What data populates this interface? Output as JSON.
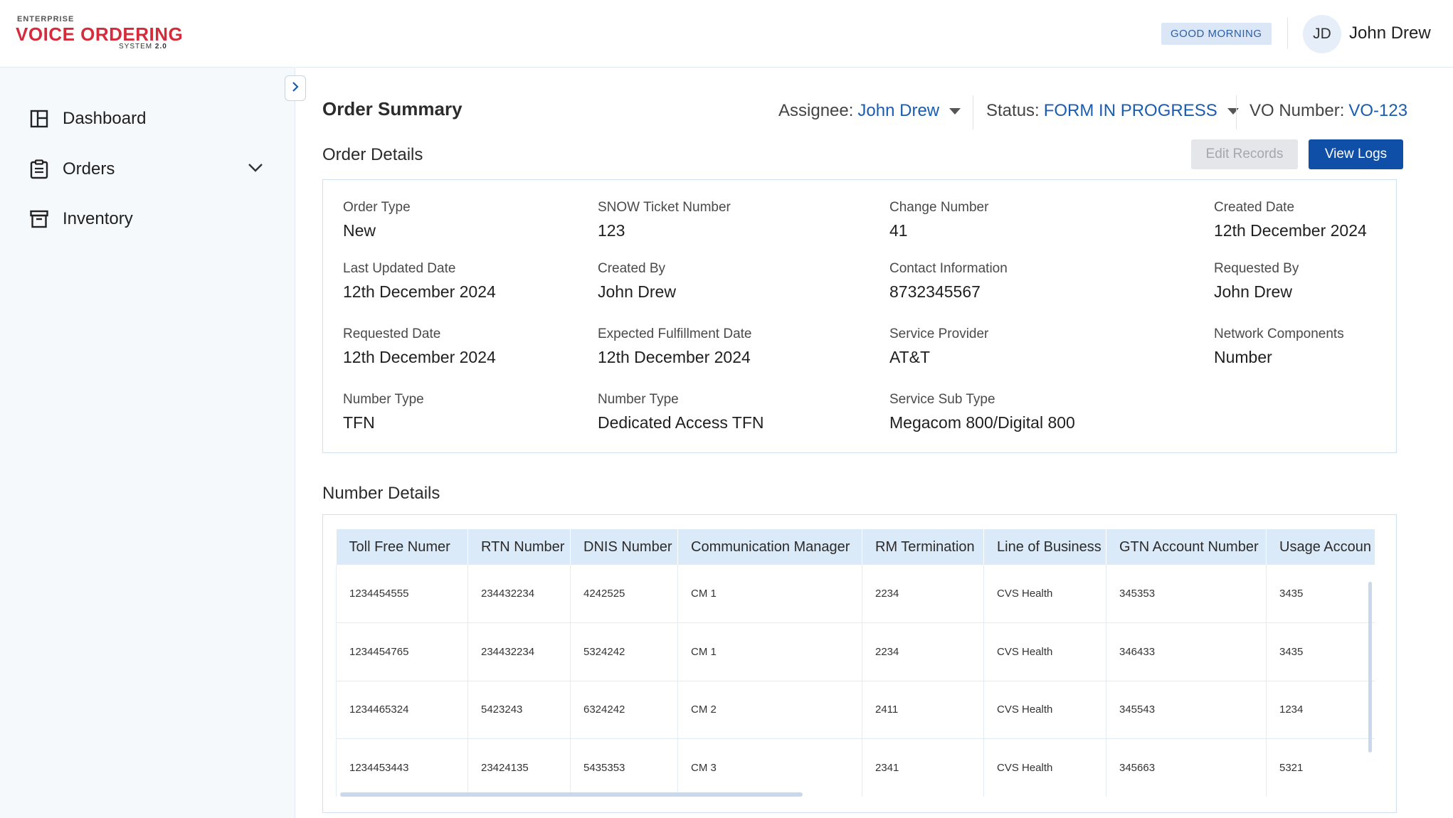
{
  "app": {
    "logo_top": "ENTERPRISE",
    "logo_main": "VOICE ORDERING",
    "logo_sub_prefix": "SYSTEM",
    "logo_sub_version": "2.0",
    "brand_color": "#d62b3a",
    "accent_color": "#0f4fa8"
  },
  "sidebar": {
    "items": [
      {
        "label": "Dashboard",
        "icon": "dashboard-icon"
      },
      {
        "label": "Orders",
        "icon": "clipboard-icon"
      },
      {
        "label": "Inventory",
        "icon": "archive-icon"
      }
    ]
  },
  "header": {
    "greeting": "GOOD MORNING",
    "avatar_initials": "JD",
    "user_name": "John Drew"
  },
  "summary": {
    "title": "Order Summary",
    "assignee_label": "Assignee:",
    "assignee_value": "John Drew",
    "status_label": "Status:",
    "status_value": "FORM IN PROGRESS",
    "vo_label": "VO Number:",
    "vo_value": "VO-123"
  },
  "order_details": {
    "title": "Order Details",
    "edit_label": "Edit Records",
    "logs_label": "View Logs",
    "fields": [
      {
        "label": "Order Type",
        "value": "New"
      },
      {
        "label": "SNOW Ticket Number",
        "value": "123"
      },
      {
        "label": "Change Number",
        "value": "41"
      },
      {
        "label": "Created Date",
        "value": "12th December 2024"
      },
      {
        "label": "Last Updated Date",
        "value": "12th December 2024"
      },
      {
        "label": "Created By",
        "value": "John Drew"
      },
      {
        "label": "Contact Information",
        "value": "8732345567"
      },
      {
        "label": "Requested By",
        "value": "John Drew"
      },
      {
        "label": "Requested Date",
        "value": "12th December 2024"
      },
      {
        "label": "Expected Fulfillment Date",
        "value": "12th December 2024"
      },
      {
        "label": "Service Provider",
        "value": "AT&T"
      },
      {
        "label": "Network Components",
        "value": "Number"
      },
      {
        "label": "Number Type",
        "value": "TFN"
      },
      {
        "label": "Number Type",
        "value": "Dedicated Access TFN"
      },
      {
        "label": "Service Sub Type",
        "value": "Megacom 800/Digital 800"
      }
    ]
  },
  "number_details": {
    "title": "Number Details",
    "columns": [
      "Toll Free Numer",
      "RTN Number",
      "DNIS Number",
      "Communication Manager",
      "RM Termination",
      "Line of Business",
      "GTN Account Number",
      "Usage Accoun"
    ],
    "rows": [
      [
        "1234454555",
        "234432234",
        "4242525",
        "CM 1",
        "2234",
        "CVS Health",
        "345353",
        "3435"
      ],
      [
        "1234454765",
        "234432234",
        "5324242",
        "CM 1",
        "2234",
        "CVS Health",
        "346433",
        "3435"
      ],
      [
        "1234465324",
        "5423243",
        "6324242",
        "CM 2",
        "2411",
        "CVS Health",
        "345543",
        "1234"
      ],
      [
        "1234453443",
        "23424135",
        "5435353",
        "CM 3",
        "2341",
        "CVS Health",
        "345663",
        "5321"
      ]
    ]
  }
}
